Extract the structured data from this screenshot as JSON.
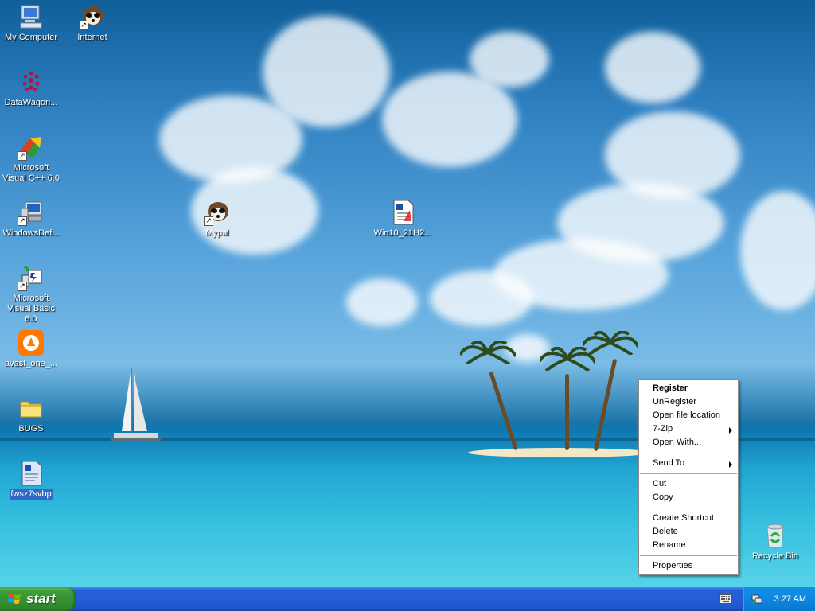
{
  "desktop": {
    "icons": [
      {
        "name": "my-computer-icon",
        "label": "My Computer"
      },
      {
        "name": "internet-icon",
        "label": "Internet"
      },
      {
        "name": "datawagon-icon",
        "label": "DataWagon..."
      },
      {
        "name": "visual-cpp-icon",
        "label": "Microsoft Visual C++ 6.0"
      },
      {
        "name": "windows-defender-icon",
        "label": "WindowsDef..."
      },
      {
        "name": "mypal-icon",
        "label": "Mypal"
      },
      {
        "name": "win10-doc-icon",
        "label": "Win10_21H2..."
      },
      {
        "name": "visual-basic-icon",
        "label": "Microsoft Visual Basic 6.0"
      },
      {
        "name": "avast-icon",
        "label": "avast_one_..."
      },
      {
        "name": "bugs-folder-icon",
        "label": "BUGS"
      },
      {
        "name": "fwsz-doc-icon",
        "label": "fwsz7svbp"
      },
      {
        "name": "recycle-bin-icon",
        "label": "Recycle Bin"
      }
    ]
  },
  "context_menu": {
    "items": [
      {
        "label": "Register",
        "bold": true
      },
      {
        "label": "UnRegister"
      },
      {
        "label": "Open file location"
      },
      {
        "label": "7-Zip",
        "submenu": true
      },
      {
        "label": "Open With..."
      },
      {
        "label": "Send To",
        "submenu": true
      },
      {
        "label": "Cut"
      },
      {
        "label": "Copy"
      },
      {
        "label": "Create Shortcut"
      },
      {
        "label": "Delete"
      },
      {
        "label": "Rename"
      },
      {
        "label": "Properties"
      }
    ]
  },
  "taskbar": {
    "start_label": "start",
    "clock": "3:27 AM"
  },
  "colors": {
    "taskbar": "#245edb",
    "start_button": "#3c9d3a",
    "tray": "#0f86e0",
    "selection": "#316ac5"
  }
}
